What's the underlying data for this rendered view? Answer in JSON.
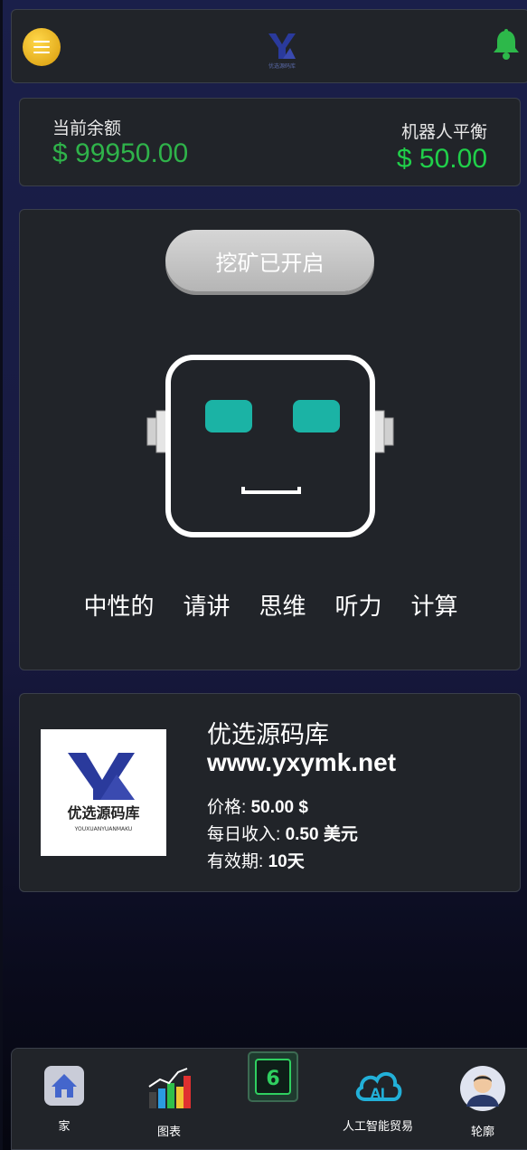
{
  "header": {
    "menu_icon": "hamburger-menu-icon",
    "logo_text": "优选源码库",
    "bell_icon": "bell-icon",
    "bell_color": "#2db84a"
  },
  "balance": {
    "current_label": "当前余额",
    "current_value": "$ 99950.00",
    "robot_label": "机器人平衡",
    "robot_value": "$ 50.00",
    "current_color": "#2fb34a",
    "robot_color": "#20d04a"
  },
  "mining": {
    "button_label": "挖矿已开启",
    "robot_icon": "robot-face-icon",
    "eye_color": "#1bb3a5",
    "modes": [
      "中性的",
      "请讲",
      "思维",
      "听力",
      "计算"
    ]
  },
  "product": {
    "logo_text": "优选源码库",
    "logo_sub": "YOUXUANYUANMAKU",
    "name": "优选源码库",
    "url": "www.yxymk.net",
    "price_label": "价格: ",
    "price_value": "50.00 $",
    "daily_label": "每日收入: ",
    "daily_value": "0.50 美元",
    "validity_label": "有效期: ",
    "validity_value": "10天"
  },
  "nav": {
    "items": [
      {
        "label": "家",
        "icon": "home-icon"
      },
      {
        "label": "图表",
        "icon": "chart-icon"
      },
      {
        "label": "",
        "icon": "mining-chip-icon"
      },
      {
        "label": "人工智能贸易",
        "icon": "ai-cloud-icon"
      },
      {
        "label": "轮廓",
        "icon": "profile-avatar-icon"
      }
    ]
  }
}
